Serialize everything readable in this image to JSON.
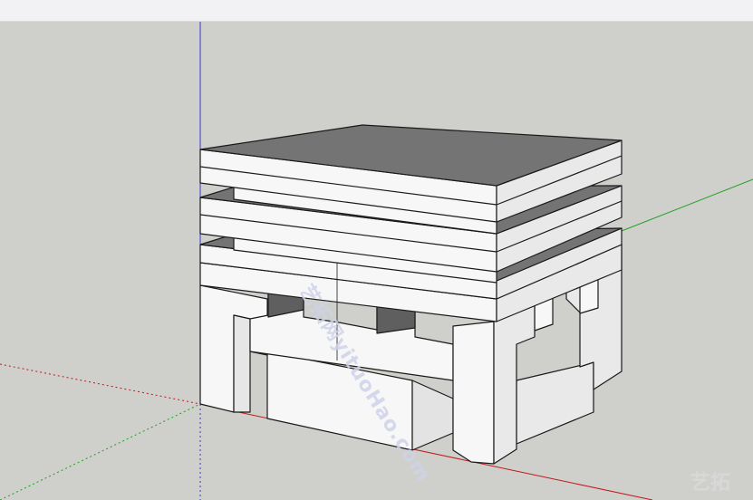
{
  "app": {
    "window": "SketchUp 3D modeling viewport"
  },
  "colors": {
    "toolbar_bg": "#f2f2f5",
    "viewport_bg": "#cfcfcb",
    "face_front": "#f7f7f7",
    "face_side": "#e9e9e9",
    "face_top": "#747474",
    "face_shadow": "#5f5f5f",
    "edge": "#1a1a1a",
    "axis_blue": "#3a3ad0",
    "axis_red": "#c01a1a",
    "axis_green": "#1fa01f"
  },
  "viewport": {
    "watermark_text": "艺拓网yituoHao.com",
    "corner_logo": "艺拓"
  }
}
